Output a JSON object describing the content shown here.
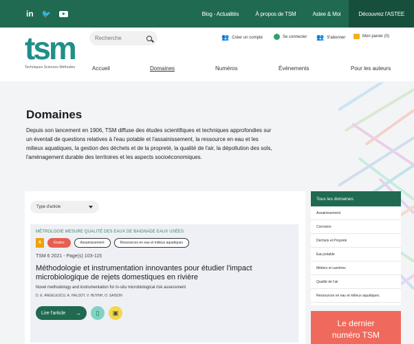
{
  "topbar": {
    "social": [
      {
        "icon": "linkedin-icon",
        "glyph": "in"
      },
      {
        "icon": "twitter-icon",
        "glyph": "🐦"
      },
      {
        "icon": "youtube-icon",
        "glyph": ""
      }
    ],
    "links": [
      "Blog - Actualités",
      "À propos de TSM",
      "Astee & Moi",
      "Découvrez l'ASTEE"
    ]
  },
  "header": {
    "logo": "tsm",
    "logo_sub": "Techniques Sciences Méthodes",
    "search_placeholder": "Recherche",
    "account": {
      "create": "Créer un compte",
      "login": "Se connecter",
      "subscribe": "S'abonner",
      "cart": "Mon panier (0)"
    },
    "nav": [
      "Accueil",
      "Domaines",
      "Numéros",
      "Événements",
      "Pour les auteurs"
    ]
  },
  "hero": {
    "title": "Domaines",
    "text": "Depuis son lancement en 1906, TSM diffuse des études scientifiques et techniques approfondies sur un éventail de questions relatives à l'eau potable et l'assainissement, la ressource en eau et les milieux aquatiques, la gestion des déchets et de la propreté, la qualité de l'air, la dépollution des sols, l'aménagement durable des territoires et les aspects socioéconomiques."
  },
  "filter": {
    "type_label": "Type d'article"
  },
  "article": {
    "categories": "MÉTROLOGIE MESURE   QUALITÉ DES EAUX DE BAIGNADE   EAUX USÉES",
    "badge": "A",
    "tags": [
      "Études",
      "Assainissement",
      "Ressources en eau et milieux aquatiques"
    ],
    "meta": "TSM 6 2021 - Page(s) 103-115",
    "title": "Méthodologie et instrumentation innovantes pour étudier l'impact microbiologique de rejets domestiques en rivière",
    "subtitle": "Novel methodology and instrumentation for in-situ microbiological risk assessment",
    "authors": "D. E. ANGELESCU, A. HALSOT, V. HUYNH, O. SAISON",
    "read_label": "Lire l'article"
  },
  "sidebar": {
    "head": "Tous les domaines",
    "items": [
      "Assainissement",
      "Corrosion",
      "Déchets et Propreté",
      "Eau potable",
      "Métiers et carrières",
      "Qualité de l'air",
      "Ressources en eau et milieux aquatiques"
    ]
  },
  "promo": {
    "line1": "Le dernier",
    "line2": "numéro TSM"
  },
  "colors": {
    "brand_green": "#1f6a51",
    "accent_coral": "#ef6a5c",
    "accent_teal": "#1f8f8a"
  }
}
